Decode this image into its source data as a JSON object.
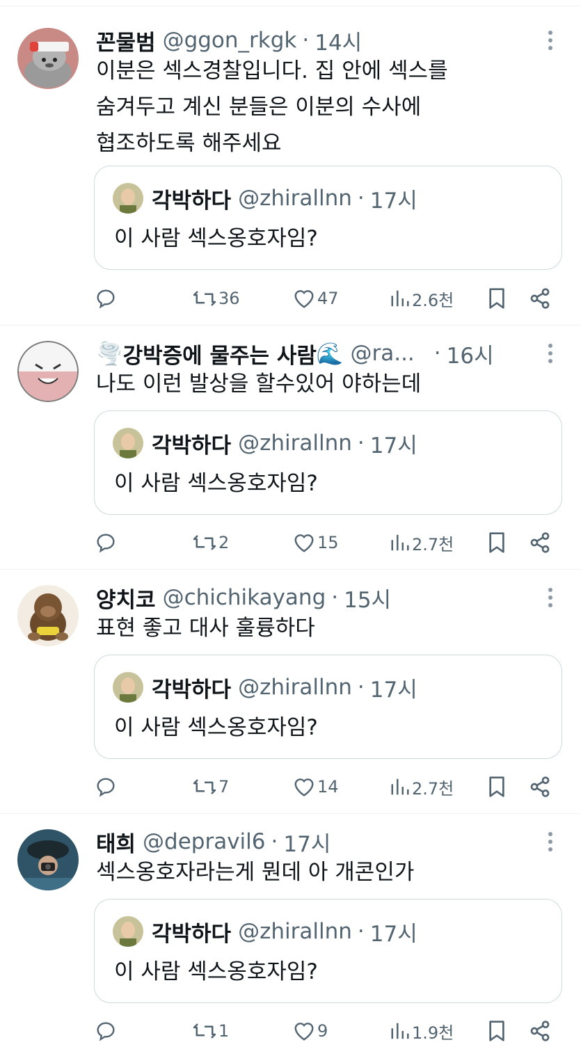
{
  "tweets": [
    {
      "name": "꼰물범",
      "handle": "@ggon_rkgk",
      "time": "14시",
      "text_lines": [
        "이분은 섹스경찰입니다. 집 안에 섹스를",
        "숨겨두고 계신 분들은 이분의 수사에",
        "협조하도록 해주세요"
      ],
      "avatar_icon": "seal-avatar-icon",
      "quote": {
        "name": "각박하다",
        "handle": "@zhirallnn",
        "time": "17시",
        "text": "이 사람 섹스옹호자임?"
      },
      "stats": {
        "replies": "",
        "retweets": "36",
        "likes": "47",
        "views": "2.6천"
      }
    },
    {
      "name_emoji_left": "🌪️",
      "name": "강박증에 물주는 사람",
      "name_emoji_right": "🌊",
      "handle": "@ra...",
      "time": "16시",
      "text_lines": [
        "나도 이런 발상을 할수있어 야하는데"
      ],
      "avatar_icon": "electrode-avatar-icon",
      "quote": {
        "name": "각박하다",
        "handle": "@zhirallnn",
        "time": "17시",
        "text": "이 사람 섹스옹호자임?"
      },
      "stats": {
        "replies": "",
        "retweets": "2",
        "likes": "15",
        "views": "2.7천"
      }
    },
    {
      "name": "양치코",
      "handle": "@chichikayang",
      "time": "15시",
      "text_lines": [
        "표현 좋고 대사 훌륭하다"
      ],
      "avatar_icon": "monkey-plush-avatar-icon",
      "quote": {
        "name": "각박하다",
        "handle": "@zhirallnn",
        "time": "17시",
        "text": "이 사람 섹스옹호자임?"
      },
      "stats": {
        "replies": "",
        "retweets": "7",
        "likes": "14",
        "views": "2.7천"
      }
    },
    {
      "name": "태희",
      "handle": "@depravil6",
      "time": "17시",
      "text_lines": [
        "섹스옹호자라는게 뭔데 아 개콘인가"
      ],
      "avatar_icon": "underwater-photo-avatar-icon",
      "quote": {
        "name": "각박하다",
        "handle": "@zhirallnn",
        "time": "17시",
        "text": "이 사람 섹스옹호자임?"
      },
      "stats": {
        "replies": "",
        "retweets": "1",
        "likes": "9",
        "views": "1.9천"
      }
    }
  ],
  "colors": {
    "text": "#0f1419",
    "secondary": "#536471",
    "border": "#cfd9de",
    "divider": "#eff3f4"
  }
}
